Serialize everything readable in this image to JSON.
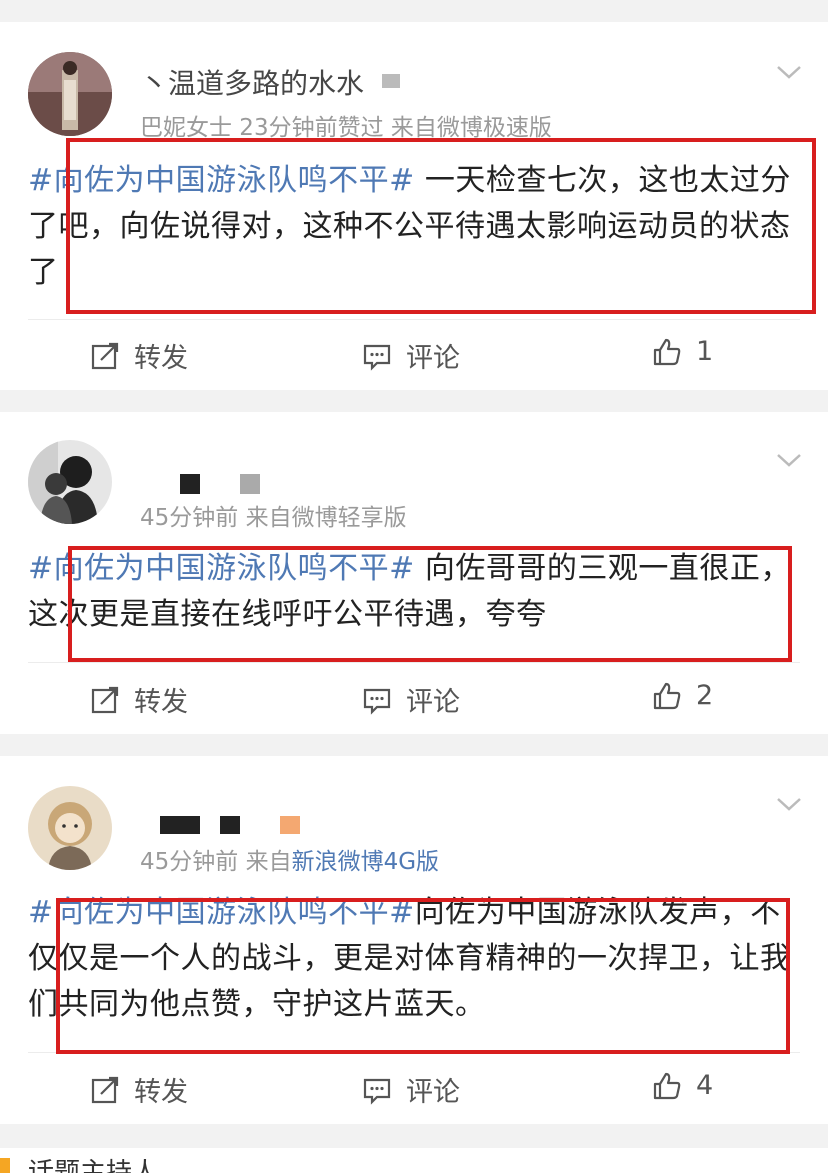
{
  "posts": [
    {
      "username": "丶温道多路的水水",
      "meta": "巴妮女士 23分钟前赞过  来自微博极速版",
      "hashtag": "#向佐为中国游泳队鸣不平#",
      "text": " 一天检查七次，这也太过分了吧，向佐说得对，这种不公平待遇太影响运动员的状态了",
      "repost_label": "转发",
      "comment_label": "评论",
      "like_count": "1"
    },
    {
      "username": "",
      "meta": "45分钟前  来自微博轻享版",
      "hashtag": "#向佐为中国游泳队鸣不平#",
      "text": " 向佐哥哥的三观一直很正，这次更是直接在线呼吁公平待遇，夸夸",
      "repost_label": "转发",
      "comment_label": "评论",
      "like_count": "2"
    },
    {
      "username": "",
      "meta": "45分钟前  来自",
      "meta_link": "新浪微博4G版",
      "hashtag": "#向佐为中国游泳队鸣不平#",
      "text": "向佐为中国游泳队发声，不仅仅是一个人的战斗，更是对体育精神的一次捍卫，让我们共同为他点赞，守护这片蓝天。",
      "repost_label": "转发",
      "comment_label": "评论",
      "like_count": "4"
    }
  ],
  "bottom": {
    "partial_text": "话题主持人"
  },
  "colors": {
    "hashtag": "#4f79b4",
    "highlight_box": "#d81e1e",
    "meta": "#9a9a9a",
    "background": "#f2f2f2"
  },
  "icons": [
    "repost-icon",
    "comment-icon",
    "like-icon",
    "chevron-down-icon"
  ]
}
